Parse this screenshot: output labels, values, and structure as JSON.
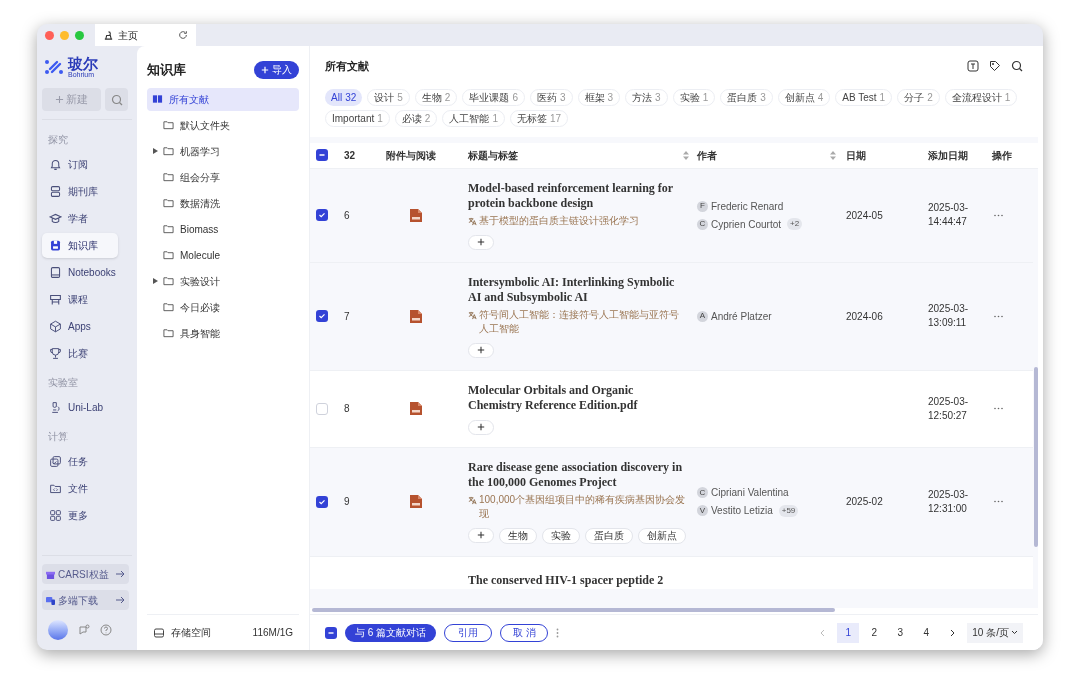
{
  "window": {
    "tab_title": "主页"
  },
  "brand": {
    "name": "玻尔",
    "sub": "Bohrium"
  },
  "rail": {
    "new_button": "新建",
    "sections": [
      {
        "title": "探究",
        "items": [
          {
            "label": "订阅",
            "selected": false
          },
          {
            "label": "期刊库",
            "selected": false
          },
          {
            "label": "学者",
            "selected": false
          },
          {
            "label": "知识库",
            "selected": true
          },
          {
            "label": "Notebooks",
            "selected": false
          },
          {
            "label": "课程",
            "selected": false
          },
          {
            "label": "Apps",
            "selected": false
          },
          {
            "label": "比赛",
            "selected": false
          }
        ]
      },
      {
        "title": "实验室",
        "items": [
          {
            "label": "Uni-Lab",
            "selected": false
          }
        ]
      },
      {
        "title": "计算",
        "items": [
          {
            "label": "任务",
            "selected": false
          },
          {
            "label": "文件",
            "selected": false
          },
          {
            "label": "更多",
            "selected": false
          }
        ]
      }
    ],
    "promos": [
      "CARSI权益",
      "多端下载"
    ]
  },
  "library": {
    "title": "知识库",
    "import_button": "导入",
    "folders": [
      {
        "label": "所有文献",
        "selected": true,
        "kind": "all",
        "expandable": false
      },
      {
        "label": "默认文件夹",
        "selected": false,
        "kind": "folder",
        "expandable": false
      },
      {
        "label": "机器学习",
        "selected": false,
        "kind": "folder",
        "expandable": true
      },
      {
        "label": "组会分享",
        "selected": false,
        "kind": "folder",
        "expandable": false
      },
      {
        "label": "数据清洗",
        "selected": false,
        "kind": "folder",
        "expandable": false
      },
      {
        "label": "Biomass",
        "selected": false,
        "kind": "folder",
        "expandable": false
      },
      {
        "label": "Molecule",
        "selected": false,
        "kind": "folder",
        "expandable": false
      },
      {
        "label": "实验设计",
        "selected": false,
        "kind": "folder",
        "expandable": true
      },
      {
        "label": "今日必读",
        "selected": false,
        "kind": "folder",
        "expandable": false
      },
      {
        "label": "具身智能",
        "selected": false,
        "kind": "folder",
        "expandable": false
      }
    ],
    "storage": {
      "label": "存储空间",
      "value": "116M/1G"
    }
  },
  "main": {
    "title": "所有文献",
    "filters": [
      {
        "label": "All",
        "count": "32",
        "selected": true
      },
      {
        "label": "设计",
        "count": "5",
        "selected": false
      },
      {
        "label": "生物",
        "count": "2",
        "selected": false
      },
      {
        "label": "毕业课题",
        "count": "6",
        "selected": false
      },
      {
        "label": "医药",
        "count": "3",
        "selected": false
      },
      {
        "label": "框架",
        "count": "3",
        "selected": false
      },
      {
        "label": "方法",
        "count": "3",
        "selected": false
      },
      {
        "label": "实验",
        "count": "1",
        "selected": false
      },
      {
        "label": "蛋白质",
        "count": "3",
        "selected": false
      },
      {
        "label": "创新点",
        "count": "4",
        "selected": false
      },
      {
        "label": "AB Test",
        "count": "1",
        "selected": false
      },
      {
        "label": "分子",
        "count": "2",
        "selected": false
      },
      {
        "label": "全流程设计",
        "count": "1",
        "selected": false
      },
      {
        "label": "Important",
        "count": "1",
        "selected": false
      },
      {
        "label": "必读",
        "count": "2",
        "selected": false
      },
      {
        "label": "人工智能",
        "count": "1",
        "selected": false
      },
      {
        "label": "无标签",
        "count": "17",
        "selected": false
      }
    ],
    "table": {
      "select_all_partial": true,
      "total": "32",
      "columns": [
        "附件与阅读",
        "标题与标签",
        "作者",
        "日期",
        "添加日期",
        "操作"
      ],
      "rows": [
        {
          "index": "6",
          "checked": true,
          "title": "Model-based reinforcement learning for protein backbone design",
          "translation": "基于模型的蛋白质主链设计强化学习",
          "tags": [],
          "authors": [
            {
              "initial": "F",
              "name": "Frederic Renard"
            },
            {
              "initial": "C",
              "name": "Cyprien Courtot",
              "more": "+2"
            }
          ],
          "date": "2024-05",
          "added_date": "2025-03-",
          "added_time": "14:44:47"
        },
        {
          "index": "7",
          "checked": true,
          "title": "Intersymbolic AI: Interlinking Symbolic AI and Subsymbolic AI",
          "translation": "符号间人工智能：连接符号人工智能与亚符号人工智能",
          "tags": [],
          "authors": [
            {
              "initial": "A",
              "name": "André Platzer"
            }
          ],
          "date": "2024-06",
          "added_date": "2025-03-",
          "added_time": "13:09:11"
        },
        {
          "index": "8",
          "checked": false,
          "title": "Molecular Orbitals and Organic Chemistry Reference Edition.pdf",
          "tags": [],
          "authors": [],
          "added_date": "2025-03-",
          "added_time": "12:50:27"
        },
        {
          "index": "9",
          "checked": true,
          "title": "Rare disease gene association discovery in the 100,000 Genomes Project",
          "translation": "100,000个基因组项目中的稀有疾病基因协会发现",
          "tags": [
            "生物",
            "实验",
            "蛋白质",
            "创新点"
          ],
          "authors": [
            {
              "initial": "C",
              "name": "Cipriani Valentina"
            },
            {
              "initial": "V",
              "name": "Vestito Letizia",
              "more": "+59"
            }
          ],
          "date": "2025-02",
          "added_date": "2025-03-",
          "added_time": "12:31:00"
        }
      ],
      "partial_row_title": "The conserved HIV-1 spacer peptide 2"
    },
    "footer": {
      "select_all_partial": true,
      "chat_button": "与 6 篇文献对话",
      "cite_button": "引用",
      "cancel_button": "取 消",
      "pages": [
        {
          "label": "1",
          "selected": true
        },
        {
          "label": "2",
          "selected": false
        },
        {
          "label": "3",
          "selected": false
        },
        {
          "label": "4",
          "selected": false
        }
      ],
      "page_size": "10 条/页"
    }
  }
}
